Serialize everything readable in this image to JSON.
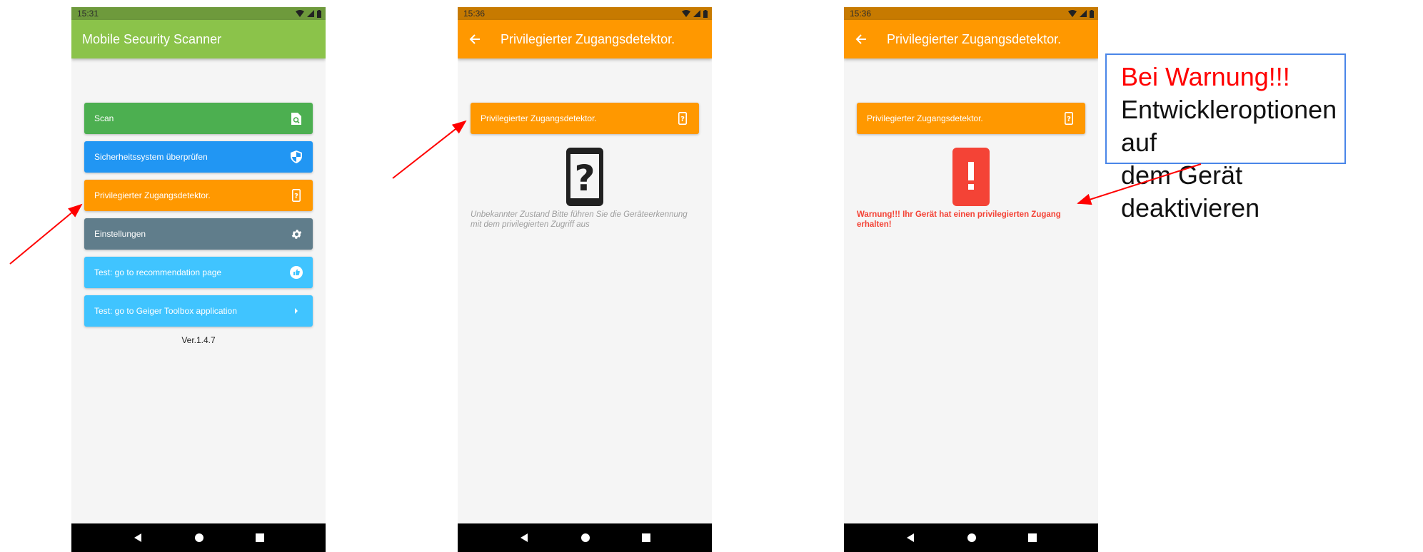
{
  "colors": {
    "green": "#4caf50",
    "blue": "#2196f3",
    "orange": "#ff9800",
    "slate": "#607d8b",
    "lightblue": "#40c4ff",
    "appbar_green": "#8bc34a",
    "warn_red": "#f44336",
    "arrow_red": "#ff0000"
  },
  "phone1": {
    "status": {
      "time": "15:31"
    },
    "appbar": {
      "title": "Mobile Security Scanner"
    },
    "menu": [
      {
        "label": "Scan",
        "icon": "scan-search-icon"
      },
      {
        "label": "Sicherheitssystem überprüfen",
        "icon": "shield-icon"
      },
      {
        "label": "Privilegierter Zugangsdetektor.",
        "icon": "phone-question-icon"
      },
      {
        "label": "Einstellungen",
        "icon": "gear-icon"
      },
      {
        "label": "Test: go to recommendation page",
        "icon": "thumbs-up-icon"
      },
      {
        "label": "Test: go to Geiger Toolbox application",
        "icon": "chevron-right-icon"
      }
    ],
    "version": "Ver.1.4.7"
  },
  "phone2": {
    "status": {
      "time": "15:36"
    },
    "appbar": {
      "title": "Privilegierter Zugangsdetektor."
    },
    "button": {
      "label": "Privilegierter Zugangsdetektor."
    },
    "state_icon": "phone-question-icon",
    "description": "Unbekannter Zustand Bitte führen Sie die Geräteerkennung mit dem privilegierten Zugriff aus"
  },
  "phone3": {
    "status": {
      "time": "15:36"
    },
    "appbar": {
      "title": "Privilegierter Zugangsdetektor."
    },
    "button": {
      "label": "Privilegierter Zugangsdetektor."
    },
    "state_icon": "phone-alert-icon",
    "warning": "Warnung!!! Ihr Gerät hat einen privilegierten Zugang erhalten!"
  },
  "callout": {
    "heading": "Bei Warnung!!!",
    "line1": "Entwickleroptionen auf",
    "line2": "dem Gerät deaktivieren"
  }
}
